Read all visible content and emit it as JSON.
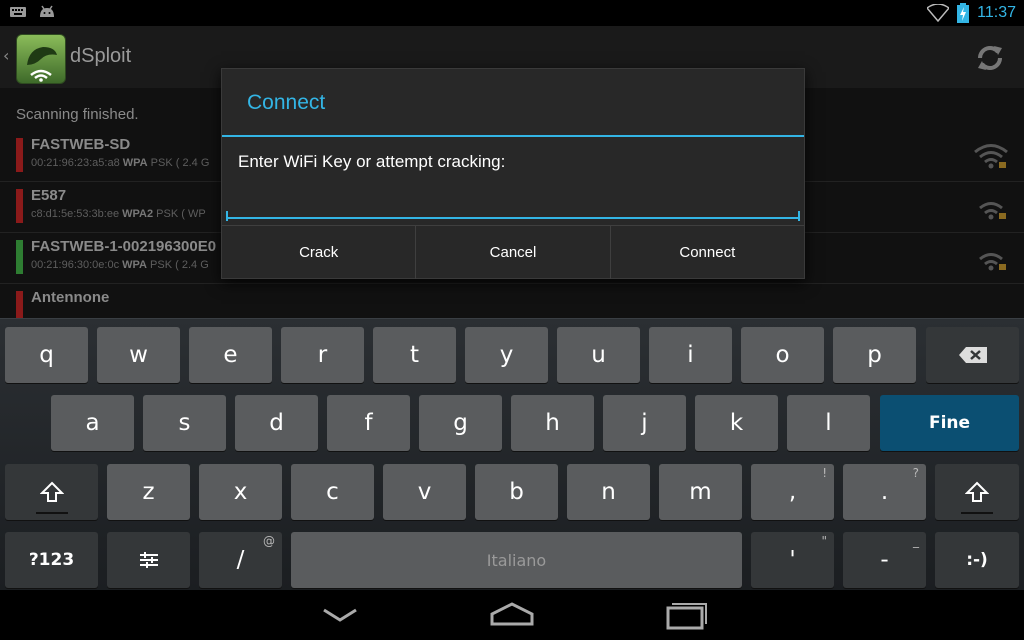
{
  "statusbar": {
    "time": "11:37",
    "left_icons": [
      "keyboard-icon",
      "android-icon"
    ],
    "right_icons": [
      "wifi-icon",
      "battery-charging-icon"
    ]
  },
  "actionbar": {
    "title": "dSploit",
    "refresh_icon": "refresh-icon"
  },
  "main": {
    "status": "Scanning finished.",
    "networks": [
      {
        "name": "FASTWEB-SD",
        "mac": "00:21:96:23:a5:a8",
        "security": "WPA",
        "extra": " PSK ( 2.4 G",
        "color": "#8b1a1a"
      },
      {
        "name": "E587",
        "mac": "c8:d1:5e:53:3b:ee",
        "security": "WPA2",
        "extra": " PSK ( WP",
        "color": "#8b1a1a"
      },
      {
        "name": "FASTWEB-1-002196300E0",
        "mac": "00:21:96:30:0e:0c",
        "security": "WPA",
        "extra": " PSK ( 2.4 G",
        "color": "#2e7d32"
      },
      {
        "name": "Antennone",
        "mac": "",
        "security": "",
        "extra": "",
        "color": "#8b1a1a"
      }
    ]
  },
  "dialog": {
    "title": "Connect",
    "message": "Enter WiFi Key or attempt cracking:",
    "input_value": "",
    "buttons": {
      "crack": "Crack",
      "cancel": "Cancel",
      "connect": "Connect"
    }
  },
  "keyboard": {
    "row1": [
      "q",
      "w",
      "e",
      "r",
      "t",
      "y",
      "u",
      "i",
      "o",
      "p"
    ],
    "row2": [
      "a",
      "s",
      "d",
      "f",
      "g",
      "h",
      "j",
      "k",
      "l"
    ],
    "row3": [
      "z",
      "x",
      "c",
      "v",
      "b",
      "n",
      "m"
    ],
    "fine": "Fine",
    "comma": ",",
    "comma_hint": "!",
    "period": ".",
    "period_hint": "?",
    "symbols": "?123",
    "slash": "/",
    "slash_hint": "@",
    "space": "Italiano",
    "apostrophe": "'",
    "apostrophe_hint": "\"",
    "dash": "-",
    "dash_hint": "_",
    "smiley": ":-)",
    "accent": "#0b4f72"
  },
  "navbar": {
    "icons": [
      "back-icon",
      "home-icon",
      "recents-icon"
    ]
  }
}
